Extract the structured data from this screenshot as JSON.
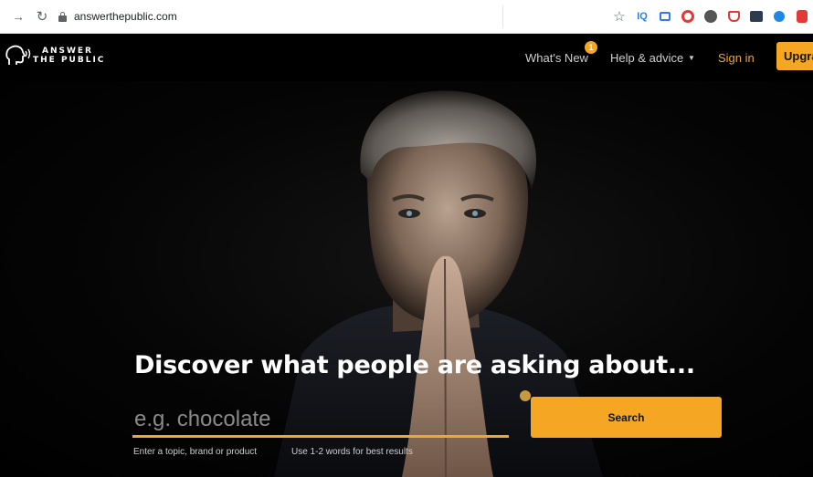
{
  "browser": {
    "url": "answerthepublic.com",
    "icons": [
      "forward-icon",
      "reload-icon",
      "lock-icon",
      "star-icon",
      "iq-extension-icon",
      "square-extension-icon",
      "ring-extension-icon",
      "gear-extension-icon",
      "pocket-extension-icon",
      "box-extension-icon",
      "blue-extension-icon",
      "red-extension-icon"
    ]
  },
  "header": {
    "logo_line1": "ANSWER",
    "logo_line2": "THE PUBLIC",
    "whats_new": "What's New",
    "whats_new_badge": "1",
    "help": "Help & advice",
    "sign_in": "Sign in",
    "upgrade": "Upgrade"
  },
  "hero": {
    "headline": "Discover what people are asking about...",
    "search_placeholder": "e.g. chocolate",
    "search_button": "Search",
    "hint_1": "Enter a topic, brand or product",
    "hint_2": "Use 1-2 words for best results"
  },
  "colors": {
    "accent": "#f5a623",
    "background": "#000000",
    "text": "#ffffff"
  }
}
